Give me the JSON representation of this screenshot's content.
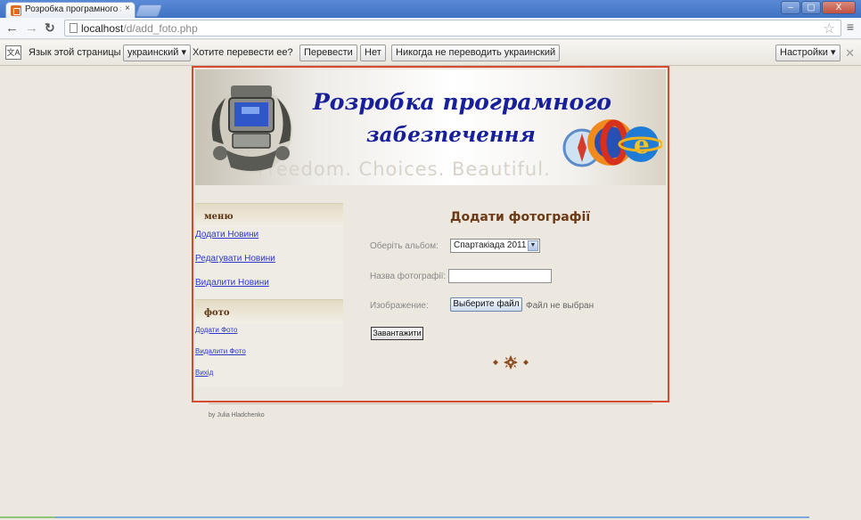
{
  "browser": {
    "tab_title": "Розробка програмного забе",
    "tab_close": "×",
    "url_host": "localhost",
    "url_path": "/d/add_foto.php",
    "window_controls": [
      "–",
      "▢",
      "X"
    ]
  },
  "translate_bar": {
    "lang_prefix": "Язык этой страницы",
    "language": "украинский",
    "question": "Хотите перевести ее?",
    "translate_button": "Перевести",
    "no_button": "Нет",
    "never_button": "Никогда не переводить украинский",
    "settings_button": "Настройки"
  },
  "header": {
    "title_line1": "Розробка програмного",
    "title_line2": "забезпечення",
    "watermark": "Freedom. Choices. Beautiful."
  },
  "sidebar": {
    "sections": [
      {
        "title": "меню",
        "links": [
          "Додати Новини",
          "Редагувати Новини",
          "Видалити Новини"
        ]
      },
      {
        "title": "фото",
        "links": [
          "Додати Фото",
          "Видалити Фото",
          "Вихід"
        ]
      }
    ]
  },
  "form": {
    "title": "Додати фотографії",
    "album_label": "Оберіть альбом:",
    "album_value": "Спартакіада 2011",
    "name_label": "Назва фотографії:",
    "name_value": "",
    "image_label": "Изображение:",
    "file_button": "Выберите файл",
    "file_status": "Файл не выбран",
    "submit_button": "Завантажити"
  },
  "footer": {
    "credit": "by Julia Hladchenko"
  },
  "colors": {
    "frame_border": "#d64a32",
    "title_blue": "#17209a",
    "link_blue": "#2e37cc",
    "heading_brown": "#6a3a16"
  }
}
